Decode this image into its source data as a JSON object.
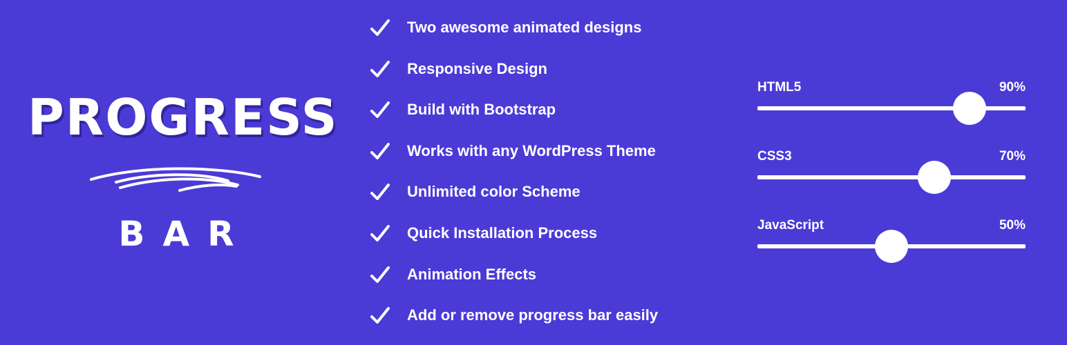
{
  "logo": {
    "title": "PROGRESS",
    "subtitle": "BAR"
  },
  "features": [
    "Two awesome animated designs",
    "Responsive Design",
    "Build with Bootstrap",
    "Works with any WordPress Theme",
    "Unlimited color Scheme",
    "Quick Installation Process",
    "Animation Effects",
    "Add or remove progress bar easily"
  ],
  "skills": [
    {
      "name": "HTML5",
      "percent_label": "90%",
      "value": 0.79
    },
    {
      "name": "CSS3",
      "percent_label": "70%",
      "value": 0.66
    },
    {
      "name": "JavaScript",
      "percent_label": "50%",
      "value": 0.5
    }
  ],
  "colors": {
    "background": "#4a3bd6",
    "foreground": "#ffffff"
  },
  "icons": {
    "feature_marker": "check-icon"
  }
}
